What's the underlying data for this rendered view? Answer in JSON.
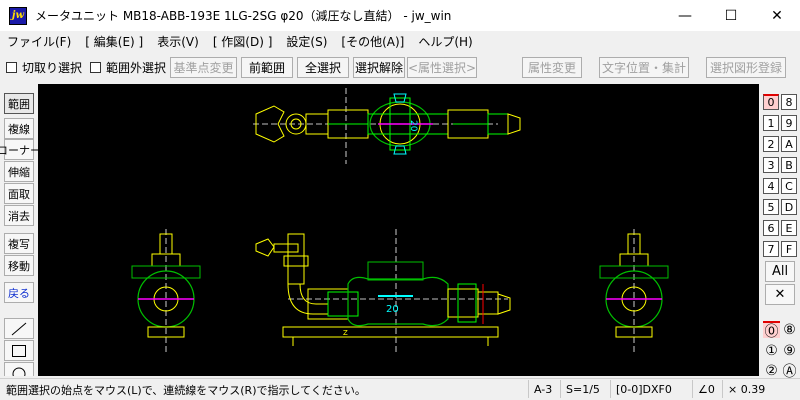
{
  "window": {
    "app_icon": "jw",
    "title": "メータユニット MB18-ABB-193E 1LG-2SG φ20（減圧なし直結） - jw_win",
    "min_glyph": "—",
    "max_glyph": "☐",
    "close_glyph": "✕"
  },
  "menu": [
    "ファイル(F)",
    "[ 編集(E) ]",
    "表示(V)",
    "[ 作図(D) ]",
    "設定(S)",
    "[その他(A)]",
    "ヘルプ(H)"
  ],
  "toolbar": {
    "check_clip": "切取り選択",
    "check_outside": "範囲外選択",
    "base_point": "基準点変更",
    "prev_range": "前範囲",
    "select_all": "全選択",
    "deselect": "選択解除",
    "attr_select": "<属性選択>",
    "attr_change": "属性変更",
    "text_pos": "文字位置・集計",
    "register_shape": "選択図形登録"
  },
  "left_tools": [
    "範囲",
    "複線",
    "コーナー",
    "伸縮",
    "面取",
    "消去",
    "複写",
    "移動",
    "戻る"
  ],
  "layers": {
    "col_a": [
      "0",
      "1",
      "2",
      "3",
      "4",
      "5",
      "6",
      "7"
    ],
    "col_b": [
      "8",
      "9",
      "A",
      "B",
      "C",
      "D",
      "E",
      "F"
    ],
    "all_label": "All",
    "x_label": "✕",
    "group_a": [
      "⓪",
      "①",
      "②"
    ],
    "group_b": [
      "⑧",
      "⑨",
      "Ⓐ"
    ]
  },
  "drawing_labels": {
    "meter_top": "20",
    "meter_front": "20",
    "base_label": "Z"
  },
  "status": {
    "message": "範囲選択の始点をマウス(L)で、連続線をマウス(R)で指示してください。",
    "paper": "A-3",
    "scale": "S=1/5",
    "layer": "[0-0]DXF0",
    "angle": "∠0",
    "factor": "× 0.39"
  },
  "colors": {
    "canvas": "#000000",
    "cad_yellow": "#ffff00",
    "cad_green": "#00c000",
    "cad_white": "#ffffff",
    "cad_magenta": "#ff00ff",
    "cad_cyan": "#00ffff",
    "layer_selected": "#e00000"
  }
}
